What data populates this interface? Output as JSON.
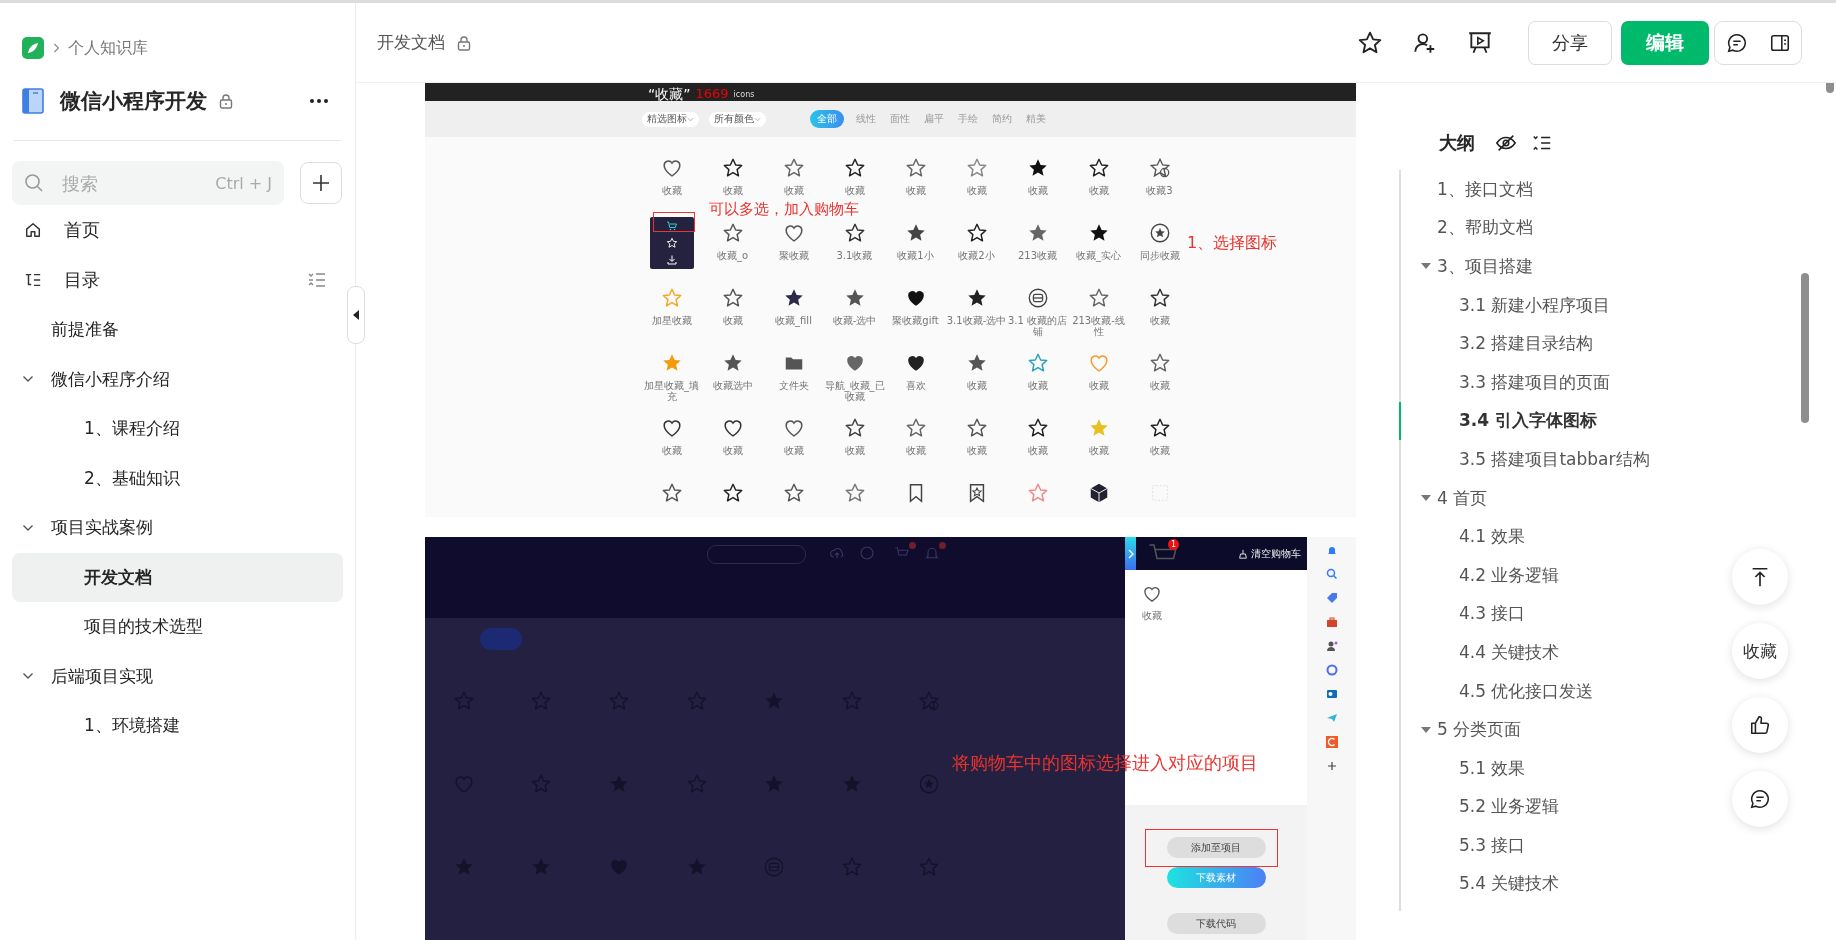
{
  "sidebar": {
    "breadcrumb": "个人知识库",
    "book_title": "微信小程序开发",
    "search": {
      "placeholder": "搜索",
      "shortcut": "Ctrl + J"
    },
    "nav": [
      {
        "kind": "home",
        "label": "首页"
      },
      {
        "kind": "toc",
        "label": "目录"
      }
    ],
    "tree": [
      {
        "label": "前提准备",
        "selected": false
      },
      {
        "label": "微信小程序介绍",
        "selected": false,
        "expanded": true,
        "children": [
          {
            "label": "1、课程介绍",
            "selected": false
          },
          {
            "label": "2、基础知识",
            "selected": false
          }
        ]
      },
      {
        "label": "项目实战案例",
        "selected": false,
        "expanded": true,
        "children": [
          {
            "label": "开发文档",
            "selected": true
          },
          {
            "label": "项目的技术选型",
            "selected": false
          }
        ]
      },
      {
        "label": "后端项目实现",
        "selected": false,
        "expanded": true,
        "children": [
          {
            "label": "1、环境搭建",
            "selected": false
          }
        ]
      }
    ]
  },
  "header": {
    "title": "开发文档",
    "share": "分享",
    "edit": "编辑"
  },
  "shot1": {
    "title": "“收藏”",
    "count": "1669",
    "unit": "icons",
    "filters": [
      "精选图标",
      "所有颜色"
    ],
    "tabs": [
      {
        "label": "全部",
        "selected": true
      },
      {
        "label": "线性",
        "selected": false
      },
      {
        "label": "面性",
        "selected": false
      },
      {
        "label": "扁平",
        "selected": false
      },
      {
        "label": "手绘",
        "selected": false
      },
      {
        "label": "简约",
        "selected": false
      },
      {
        "label": "精美",
        "selected": false
      }
    ],
    "icons": [
      {
        "kind": "heart",
        "color": "#555555",
        "label": "收藏"
      },
      {
        "kind": "star",
        "color": "#222222",
        "label": "收藏"
      },
      {
        "kind": "star",
        "color": "#666666",
        "label": "收藏"
      },
      {
        "kind": "star",
        "color": "#222222",
        "label": "收藏"
      },
      {
        "kind": "star",
        "color": "#666666",
        "label": "收藏"
      },
      {
        "kind": "star",
        "color": "#888888",
        "label": "收藏"
      },
      {
        "kind": "star-filled",
        "color": "#111111",
        "label": "收藏"
      },
      {
        "kind": "star",
        "color": "#222222",
        "label": "收藏"
      },
      {
        "kind": "star-check",
        "color": "#555555",
        "label": "收藏3"
      },
      {
        "kind": "hover-card"
      },
      {
        "kind": "star",
        "color": "#555555",
        "label": "收藏_o"
      },
      {
        "kind": "heart",
        "color": "#555555",
        "label": "聚收藏"
      },
      {
        "kind": "star",
        "color": "#333333",
        "label": "3.1收藏"
      },
      {
        "kind": "star-filled",
        "color": "#444444",
        "label": "收藏1小"
      },
      {
        "kind": "star",
        "color": "#222222",
        "label": "收藏2小"
      },
      {
        "kind": "star-filled",
        "color": "#666666",
        "label": "213收藏"
      },
      {
        "kind": "star-filled",
        "color": "#111111",
        "label": "收藏_实心"
      },
      {
        "kind": "star-circle",
        "color": "#444444",
        "label": "同步收藏"
      },
      {
        "kind": "star",
        "color": "#f5a623",
        "label": "加星收藏"
      },
      {
        "kind": "star",
        "color": "#555555",
        "label": "收藏"
      },
      {
        "kind": "star-filled",
        "color": "#2b2a4a",
        "label": "收藏_fill"
      },
      {
        "kind": "star-filled",
        "color": "#555555",
        "label": "收藏-选中"
      },
      {
        "kind": "heart-filled",
        "color": "#111111",
        "label": "聚收藏gift"
      },
      {
        "kind": "star-filled",
        "color": "#222222",
        "label": "3.1收藏-选中"
      },
      {
        "kind": "circle",
        "color": "#444444",
        "label": "3.1 收藏的店铺"
      },
      {
        "kind": "star",
        "color": "#666666",
        "label": "213收藏-线性"
      },
      {
        "kind": "star",
        "color": "#333333",
        "label": "收藏"
      },
      {
        "kind": "star-filled",
        "color": "#f59a0b",
        "label": "加星收藏_填充"
      },
      {
        "kind": "star-filled",
        "color": "#555555",
        "label": "收藏选中"
      },
      {
        "kind": "folder",
        "color": "#555555",
        "label": "文件夹"
      },
      {
        "kind": "heart-filled",
        "color": "#666666",
        "label": "导航_收藏_已收藏"
      },
      {
        "kind": "heart-filled",
        "color": "#222222",
        "label": "喜欢"
      },
      {
        "kind": "star-filled",
        "color": "#555555",
        "label": "收藏"
      },
      {
        "kind": "star",
        "color": "#2aa3b8",
        "label": "收藏"
      },
      {
        "kind": "heart",
        "color": "#f59a2b",
        "label": "收藏"
      },
      {
        "kind": "star",
        "color": "#666666",
        "label": "收藏"
      },
      {
        "kind": "heart",
        "color": "#333333",
        "label": "收藏"
      },
      {
        "kind": "heart",
        "color": "#333333",
        "label": "收藏"
      },
      {
        "kind": "heart",
        "color": "#555555",
        "label": "收藏"
      },
      {
        "kind": "star",
        "color": "#444444",
        "label": "收藏"
      },
      {
        "kind": "star",
        "color": "#666666",
        "label": "收藏"
      },
      {
        "kind": "star",
        "color": "#555555",
        "label": "收藏"
      },
      {
        "kind": "star",
        "color": "#222222",
        "label": "收藏"
      },
      {
        "kind": "star-filled",
        "color": "#e8c020",
        "label": "收藏"
      },
      {
        "kind": "star",
        "color": "#222222",
        "label": "收藏"
      },
      {
        "kind": "star",
        "color": "#555555"
      },
      {
        "kind": "star",
        "color": "#222222"
      },
      {
        "kind": "star",
        "color": "#555555"
      },
      {
        "kind": "star",
        "color": "#777777"
      },
      {
        "kind": "bookmark",
        "color": "#444444"
      },
      {
        "kind": "bookmark-star",
        "color": "#444444"
      },
      {
        "kind": "star",
        "color": "#f08a8a"
      },
      {
        "kind": "cube",
        "color": "#222233"
      },
      {
        "kind": "blank",
        "color": "#dddddd"
      }
    ],
    "notes": [
      "可以多选，加入购物车",
      "1、选择图标"
    ]
  },
  "shot2": {
    "icons": [
      {
        "kind": "star"
      },
      {
        "kind": "star"
      },
      {
        "kind": "star"
      },
      {
        "kind": "star"
      },
      {
        "kind": "star-filled"
      },
      {
        "kind": "star"
      },
      {
        "kind": "star-check"
      },
      {
        "kind": "heart"
      },
      {
        "kind": "star"
      },
      {
        "kind": "star-filled"
      },
      {
        "kind": "star"
      },
      {
        "kind": "star-filled"
      },
      {
        "kind": "star-filled"
      },
      {
        "kind": "star-circle"
      },
      {
        "kind": "star-filled"
      },
      {
        "kind": "star-filled"
      },
      {
        "kind": "heart-filled"
      },
      {
        "kind": "star-filled"
      },
      {
        "kind": "circle"
      },
      {
        "kind": "star"
      },
      {
        "kind": "star"
      }
    ],
    "cart": {
      "badge": "1",
      "clear": "清空购物车",
      "items": [
        {
          "kind": "heart",
          "label": "收藏"
        }
      ],
      "buttons": [
        {
          "label": "添加至项目",
          "kind": "plain"
        },
        {
          "label": "下载素材",
          "kind": "primary"
        },
        {
          "label": "下载代码",
          "kind": "plain"
        }
      ]
    },
    "note": "将购物车中的图标选择进入对应的项目"
  },
  "outline": {
    "title": "大纲",
    "items": [
      {
        "label": "1、接口文档",
        "selected": false
      },
      {
        "label": "2、帮助文档",
        "selected": false
      },
      {
        "label": "3、项目搭建",
        "selected": false,
        "expanded": true,
        "children": [
          {
            "label": "3.1 新建小程序项目",
            "selected": false
          },
          {
            "label": "3.2 搭建目录结构",
            "selected": false
          },
          {
            "label": "3.3 搭建项目的页面",
            "selected": false
          },
          {
            "label": "3.4 引入字体图标",
            "selected": true
          },
          {
            "label": "3.5 搭建项目tabbar结构",
            "selected": false
          }
        ]
      },
      {
        "label": "4 首页",
        "selected": false,
        "expanded": true,
        "children": [
          {
            "label": "4.1 效果",
            "selected": false
          },
          {
            "label": "4.2 业务逻辑",
            "selected": false
          },
          {
            "label": "4.3 接口",
            "selected": false
          },
          {
            "label": "4.4 关键技术",
            "selected": false
          },
          {
            "label": "4.5 优化接口发送",
            "selected": false
          }
        ]
      },
      {
        "label": "5 分类页面",
        "selected": false,
        "expanded": true,
        "children": [
          {
            "label": "5.1 效果",
            "selected": false
          },
          {
            "label": "5.2 业务逻辑",
            "selected": false
          },
          {
            "label": "5.3 接口",
            "selected": false
          },
          {
            "label": "5.4 关键技术",
            "selected": false
          }
        ]
      }
    ]
  },
  "float_label": "收藏"
}
